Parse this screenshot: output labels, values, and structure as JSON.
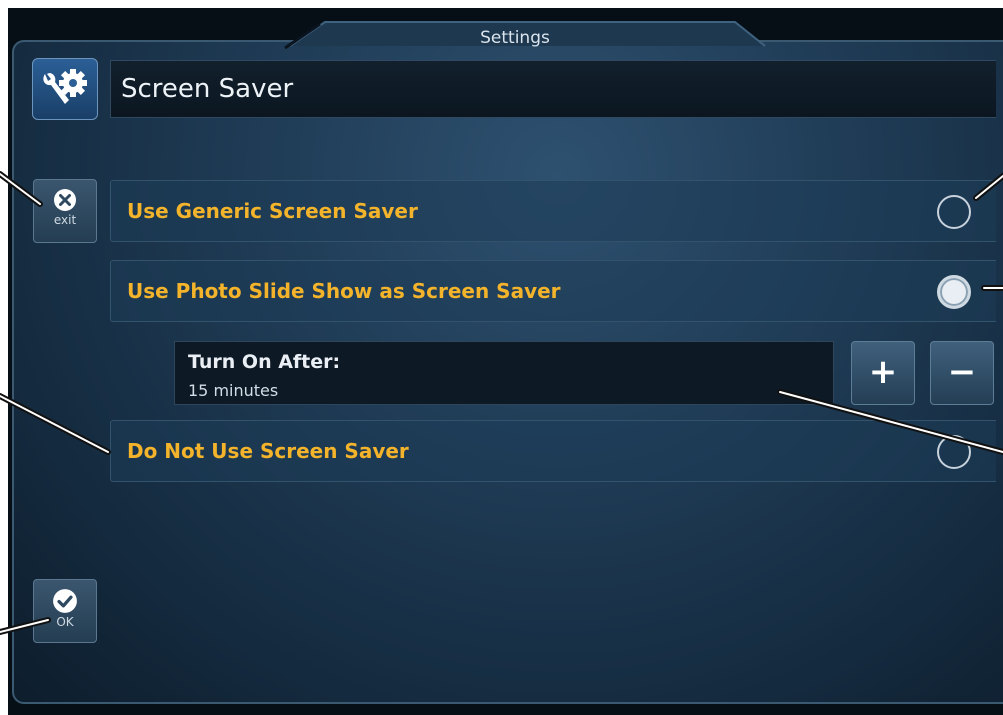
{
  "header": {
    "title": "Settings"
  },
  "page": {
    "title": "Screen Saver",
    "icon": "wrench-gear-icon"
  },
  "side_buttons": {
    "exit_label": "exit",
    "ok_label": "OK"
  },
  "options": [
    {
      "label": "Use Generic Screen Saver",
      "selected": false
    },
    {
      "label": "Use Photo Slide Show as Screen Saver",
      "selected": true
    },
    {
      "label": "Do Not Use Screen Saver",
      "selected": false
    }
  ],
  "turn_on": {
    "label": "Turn On After:",
    "value": "15 minutes",
    "plus_label": "+",
    "minus_label": "−"
  },
  "colors": {
    "accent": "#f3b42b",
    "background": "#1f3b55"
  }
}
